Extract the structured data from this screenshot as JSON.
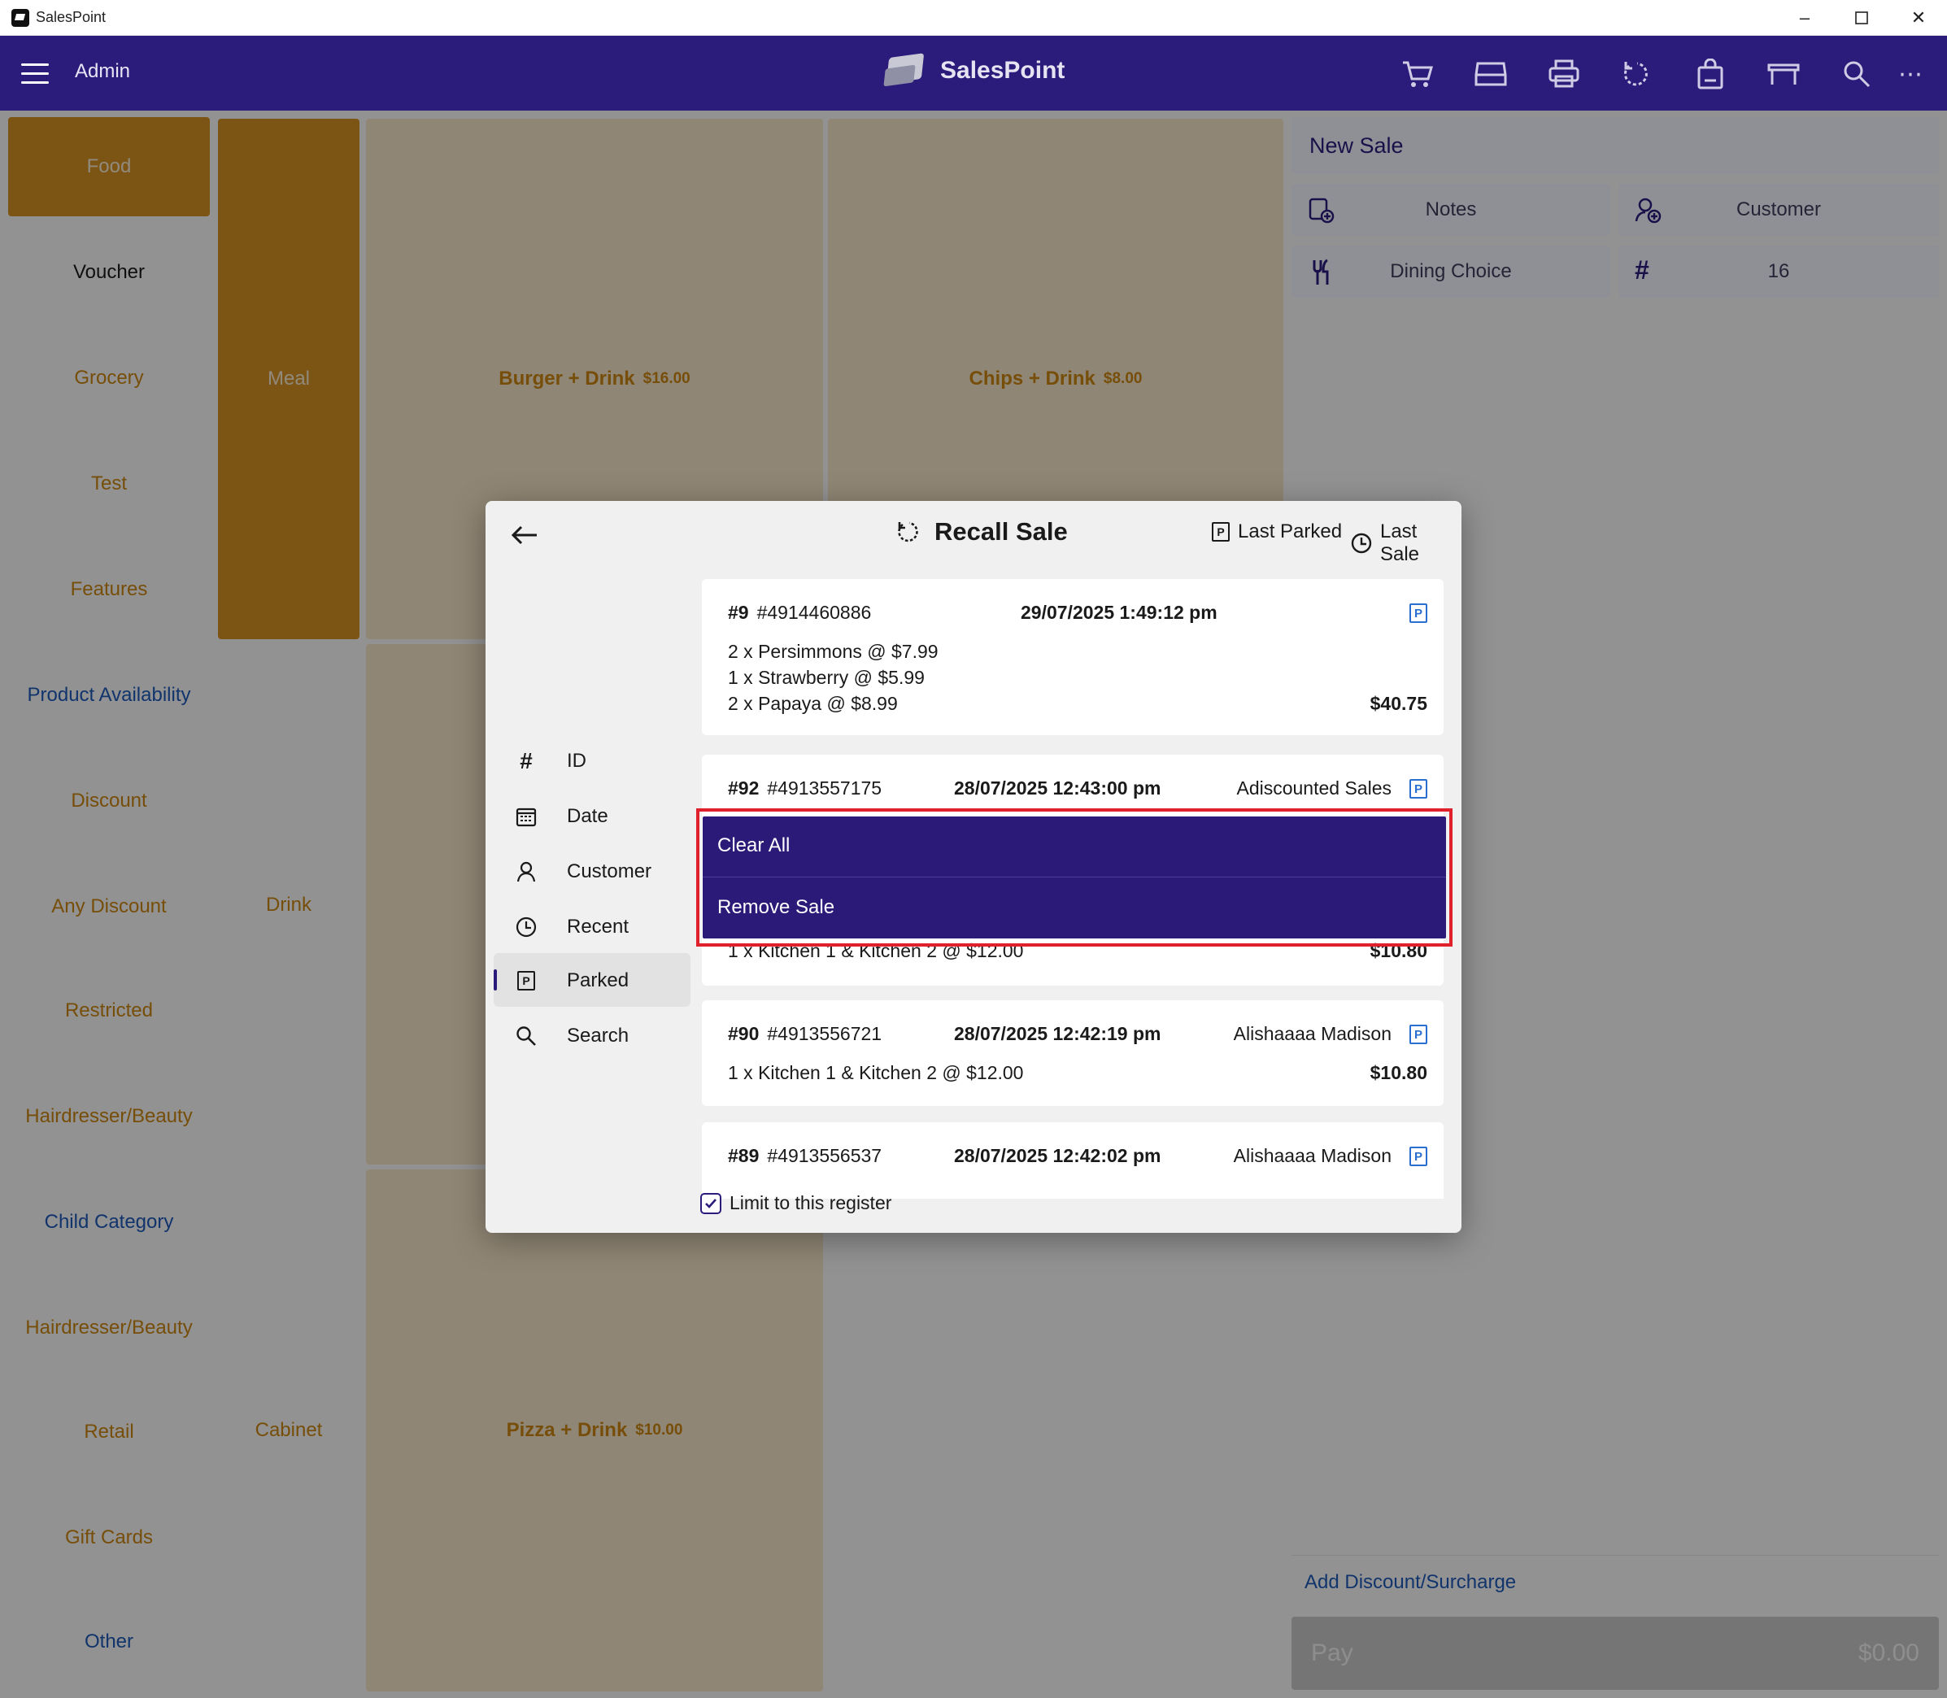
{
  "window": {
    "title": "SalesPoint"
  },
  "header": {
    "user": "Admin",
    "brand": "SalesPoint"
  },
  "categories": [
    {
      "label": "Food"
    },
    {
      "label": "Voucher"
    },
    {
      "label": "Grocery"
    },
    {
      "label": "Test"
    },
    {
      "label": "Features"
    },
    {
      "label": "Product Availability"
    },
    {
      "label": "Discount"
    },
    {
      "label": "Any Discount"
    },
    {
      "label": "Restricted"
    },
    {
      "label": "Hairdresser/Beauty"
    },
    {
      "label": "Child Category"
    },
    {
      "label": "Hairdresser/Beauty"
    },
    {
      "label": "Retail"
    },
    {
      "label": "Gift Cards"
    },
    {
      "label": "Other"
    }
  ],
  "subcategories": [
    {
      "label": "Meal"
    },
    {
      "label": "Drink"
    },
    {
      "label": "Cabinet"
    }
  ],
  "products": [
    {
      "name": "Burger + Drink",
      "price": "$16.00"
    },
    {
      "name": "Chips + Drink",
      "price": "$8.00"
    },
    {
      "name": "Pizza + Drink",
      "price": "$10.00"
    }
  ],
  "sale": {
    "title": "New Sale",
    "notes": "Notes",
    "customer": "Customer",
    "dining": "Dining Choice",
    "table": "16",
    "discount": "Add Discount/Surcharge",
    "pay": "Pay",
    "total": "$0.00"
  },
  "dialog": {
    "title": "Recall Sale",
    "last_parked": "Last Parked",
    "last_sale": "Last Sale",
    "nav": [
      {
        "label": "ID"
      },
      {
        "label": "Date"
      },
      {
        "label": "Customer"
      },
      {
        "label": "Recent"
      },
      {
        "label": "Parked"
      },
      {
        "label": "Search"
      }
    ],
    "sales": [
      {
        "num": "#9",
        "id": "#4914460886",
        "date": "29/07/2025 1:49:12 pm",
        "customer": "",
        "lines": [
          "2 x Persimmons @ $7.99",
          "1 x Strawberry @ $5.99",
          "2 x Papaya @ $8.99"
        ],
        "total": "$40.75"
      },
      {
        "num": "#92",
        "id": "#4913557175",
        "date": "28/07/2025 12:43:00 pm",
        "customer": "Adiscounted Sales",
        "lines": [
          "1 x Kitchen 1 & Kitchen 2 @ $12.00"
        ],
        "total": "$10.80"
      },
      {
        "num": "#90",
        "id": "#4913556721",
        "date": "28/07/2025 12:42:19 pm",
        "customer": "Alishaaaa Madison",
        "lines": [
          "1 x Kitchen 1 & Kitchen 2 @ $12.00"
        ],
        "total": "$10.80"
      },
      {
        "num": "#89",
        "id": "#4913556537",
        "date": "28/07/2025 12:42:02 pm",
        "customer": "Alishaaaa Madison",
        "lines": [],
        "total": ""
      }
    ],
    "limit_label": "Limit to this register",
    "limit_checked": true,
    "parked_mark": "P"
  },
  "context_menu": {
    "items": [
      {
        "label": "Clear All"
      },
      {
        "label": "Remove Sale"
      }
    ]
  },
  "colors": {
    "accent": "#2b1b7a",
    "category_active": "#cf8c22",
    "highlight": "#e0202a"
  }
}
